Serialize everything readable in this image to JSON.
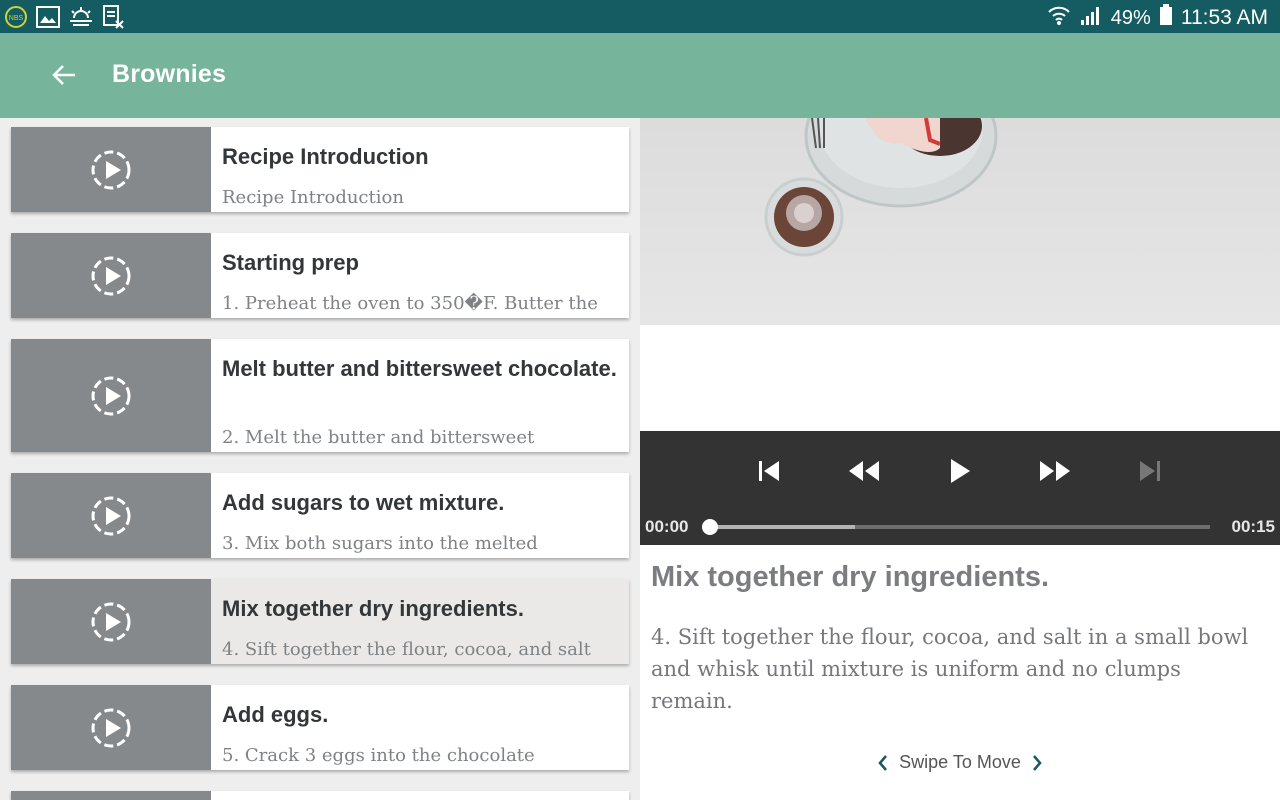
{
  "status_bar": {
    "battery": "49%",
    "time": "11:53 AM",
    "icons": [
      "nbs-app-icon",
      "gallery-icon",
      "weather-icon",
      "file-icon",
      "wifi-icon",
      "signal-icon",
      "battery-icon"
    ]
  },
  "app_bar": {
    "title": "Brownies"
  },
  "steps": [
    {
      "title": "Recipe Introduction",
      "desc": "Recipe Introduction"
    },
    {
      "title": "Starting prep",
      "desc": "1. Preheat the oven to 350�F. Butter the"
    },
    {
      "title": "Melt butter and bittersweet chocolate.",
      "desc": "2. Melt the butter and bittersweet"
    },
    {
      "title": "Add sugars to wet mixture.",
      "desc": "3. Mix both sugars into the melted"
    },
    {
      "title": "Mix together dry ingredients.",
      "desc": "4. Sift together the flour, cocoa, and salt"
    },
    {
      "title": "Add eggs.",
      "desc": "5. Crack 3 eggs into the chocolate"
    }
  ],
  "active_step": 4,
  "player": {
    "current_time": "00:00",
    "duration": "00:15",
    "progress": 0.0,
    "buffered": 0.29
  },
  "detail": {
    "title": "Mix together dry ingredients.",
    "desc": "4. Sift together the flour, cocoa, and salt in a small bowl and whisk until mixture is uniform and no clumps remain."
  },
  "swipe_label": "Swipe To Move",
  "colors": {
    "status_bar": "#155b62",
    "app_bar": "#77b49c",
    "thumb": "#86898c",
    "controls": "#333333"
  }
}
